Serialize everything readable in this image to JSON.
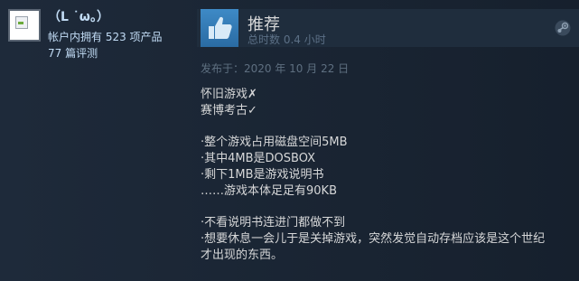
{
  "author": {
    "name": "（L ˙ω。）",
    "products_owned": "帐户内拥有 523 项产品",
    "reviews_count": "77 篇评测"
  },
  "review": {
    "verdict": "推荐",
    "playtime": "总时数 0.4 小时",
    "posted_date": "发布于：2020 年 10 月 22 日",
    "lines": [
      "怀旧游戏✗",
      "赛博考古✓",
      "·整个游戏占用磁盘空间5MB",
      "·其中4MB是DOSBOX",
      "·剩下1MB是游戏说明书",
      "……游戏本体足足有90KB",
      "·不看说明书连进门都做不到",
      "·想要休息一会儿于是关掉游戏，突然发觉自动存档应该是这个世纪",
      "才出现的东西。"
    ]
  },
  "icons": {
    "avatar": "broken-image-icon",
    "thumb": "thumbs-up-icon",
    "steam": "steam-logo-icon"
  },
  "colors": {
    "background": "#1b2838",
    "accent_blue": "#2a6ba3",
    "name_text": "#c1dbf4",
    "body_text": "#d6d7d8",
    "muted_text": "#5e6f80"
  }
}
